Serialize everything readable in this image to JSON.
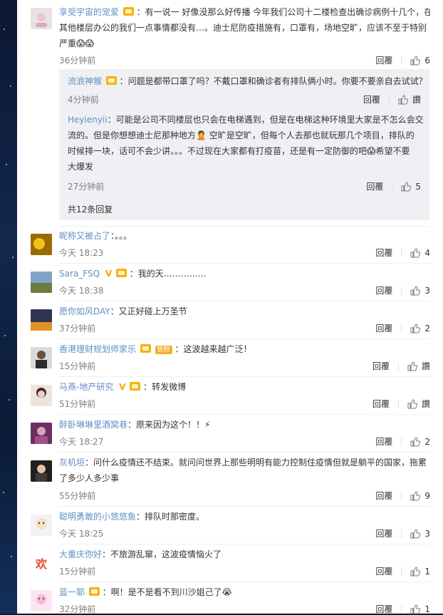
{
  "comments": [
    {
      "user": "享受宇宙的宠爱",
      "text_line1": "：有一说一 好像没那么好传播 今年我们公司十二楼检查出确诊病例十几个，在",
      "text_line2": "其他楼层办公的我们一点事情都没有…。迪士尼防疫措施有，口罩有，场地空旷，应该不至于特别",
      "text_line3": "严重😱😱",
      "time": "36分钟前",
      "reply": "回覆",
      "likes": "6"
    },
    {
      "user": "昵称又被占了",
      "text": "：。。。",
      "time": "今天 18:23",
      "reply": "回覆",
      "likes": "4"
    },
    {
      "user": "Sara_FSQ",
      "text": "：我的天……………",
      "time": "今天 18:38",
      "reply": "回覆",
      "likes": "3"
    },
    {
      "user": "愿你如风DAY",
      "text": "：又正好碰上万圣节",
      "time": "37分钟前",
      "reply": "回覆",
      "likes": "2"
    },
    {
      "user": "香港理财规划师家乐",
      "badge": "铁粉",
      "text": "：这波越来越广泛！",
      "time": "15分钟前",
      "reply": "回覆",
      "likes": "讚"
    },
    {
      "user": "马燕-地产研究",
      "text": "：转发微博",
      "time": "51分钟前",
      "reply": "回覆",
      "likes": "讚"
    },
    {
      "user": "醉卧琳琳里酒窝巷",
      "text": "：原来因为这个！！⚡",
      "time": "今天 18:27",
      "reply": "回覆",
      "likes": "2"
    },
    {
      "user": "灰机垣",
      "text_line1": "：问什么疫情还不结束。就问问世界上那些明明有能力控制住疫情但就是躺平的国家，拖累",
      "text_line2": "了多少人多少事",
      "time": "55分钟前",
      "reply": "回覆",
      "likes": "9"
    },
    {
      "user": "聪明勇敢的小悠悠鱼",
      "text": "：排队时那密度。",
      "time": "今天 18:25",
      "reply": "回覆",
      "likes": "3"
    },
    {
      "user": "大重庆你好",
      "text": "：不旅游乱窜，这波疫情恼火了",
      "time": "15分钟前",
      "reply": "回覆",
      "likes": "1"
    },
    {
      "user": "蓝一耶",
      "text": "：啊！是不是看不到川沙姐己了😭",
      "time": "32分钟前",
      "reply": "回覆",
      "likes": "1"
    }
  ],
  "subreplies": [
    {
      "user": "流浪神猴",
      "text": "：问题是都带口罩了吗？不戴口罩和确诊者有排队俩小时。你要不要亲自去试试？",
      "time": "4分钟前",
      "reply": "回覆",
      "likes": "讚"
    },
    {
      "user": "Heyienyii",
      "text_line1": "：可能是公司不同楼层也只会在电梯遇到，但是在电梯这种环境里大家是不怎么会交",
      "text_line2": "流的。但是你想想迪士尼那种地方🙎 空旷是空旷，但每个人去那也就玩那几个项目，排队的",
      "text_line3": "时候排一块，话可不会少讲。。。不过现在大家都有打疫苗，还是有一定防御的吧😱希望不要",
      "text_line4": "大爆发",
      "time": "27分钟前",
      "reply": "回覆",
      "likes": "5"
    }
  ],
  "more_replies": "共12条回复",
  "colors": {
    "name": "#eb7350",
    "link": "#5e8fc4",
    "time": "#808080"
  }
}
